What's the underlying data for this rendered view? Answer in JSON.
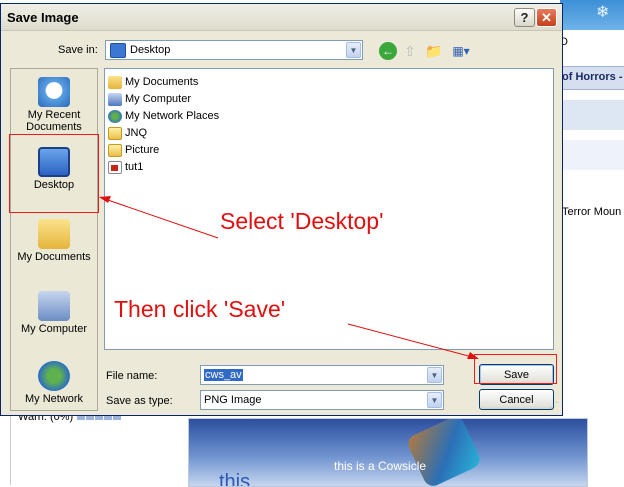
{
  "background_page": {
    "fragment_top": "D",
    "nav_text": "of Horrors -",
    "fragment_mid": "Terror Moun",
    "warn_text": "Warn: (0%)",
    "image_caption": "this is a Cowsicle",
    "image_caption_2": "this"
  },
  "dialog": {
    "title": "Save Image",
    "help_label": "?",
    "close_label": "✕",
    "save_in_label": "Save in:",
    "save_in_value": "Desktop",
    "places": [
      {
        "label": "My Recent Documents"
      },
      {
        "label": "Desktop"
      },
      {
        "label": "My Documents"
      },
      {
        "label": "My Computer"
      },
      {
        "label": "My Network"
      }
    ],
    "files": [
      {
        "name": "My Documents",
        "icon": "my-documents-icon"
      },
      {
        "name": "My Computer",
        "icon": "my-computer-icon"
      },
      {
        "name": "My Network Places",
        "icon": "network-places-icon"
      },
      {
        "name": "JNQ",
        "icon": "folder-icon"
      },
      {
        "name": "Picture",
        "icon": "folder-icon"
      },
      {
        "name": "tut1",
        "icon": "image-file-icon"
      }
    ],
    "file_name_label": "File name:",
    "file_name_value": "cws_av",
    "save_as_type_label": "Save as type:",
    "save_as_type_value": "PNG Image",
    "save_label": "Save",
    "cancel_label": "Cancel"
  },
  "annotations": {
    "select_text": "Select 'Desktop'",
    "save_text": "Then click 'Save'",
    "color": "#e0100e"
  }
}
